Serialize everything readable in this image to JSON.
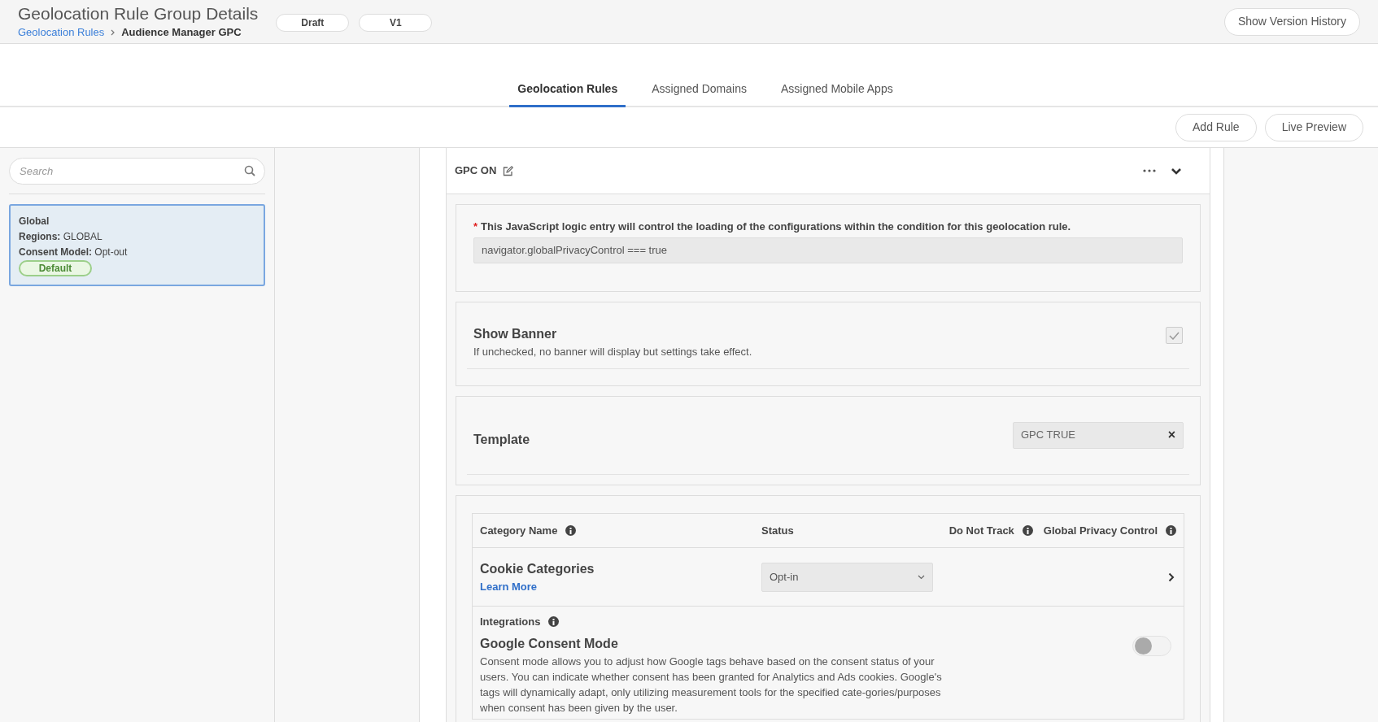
{
  "header": {
    "title": "Geolocation Rule Group Details",
    "breadcrumb": [
      {
        "label": "Geolocation Rules",
        "link": true
      },
      {
        "label": "Audience Manager GPC",
        "link": false
      }
    ],
    "badges": [
      "Draft",
      "V1"
    ],
    "version_button": "Show Version History"
  },
  "tabs": [
    {
      "label": "Geolocation Rules",
      "selected": true
    },
    {
      "label": "Assigned Domains",
      "selected": false
    },
    {
      "label": "Assigned Mobile Apps",
      "selected": false
    }
  ],
  "actions": [
    "Add Rule",
    "Live Preview"
  ],
  "sidebar": {
    "search": {
      "placeholder": "Search"
    },
    "items": [
      {
        "name": "Global",
        "regions_label": "Regions:",
        "regions": "GLOBAL",
        "consent_label": "Consent Model:",
        "consent": "Opt-out",
        "badge": "Default",
        "selected": true
      }
    ]
  },
  "rule": {
    "title": "GPC ON",
    "expanded": true,
    "condition": {
      "required_mark": "*",
      "label": "This JavaScript logic entry will control the loading of the configurations within the condition for this geolocation rule.",
      "value": "navigator.globalPrivacyControl === true"
    },
    "show_banner": {
      "title": "Show Banner",
      "description": "If unchecked, no banner will display but settings take effect.",
      "checked": true,
      "disabled": true
    },
    "template": {
      "label": "Template",
      "value": "GPC TRUE",
      "clear": "×"
    },
    "categories": {
      "columns": [
        "Category Name",
        "Status",
        "Do Not Track",
        "Global Privacy Control"
      ],
      "rows": [
        {
          "name": "Cookie Categories",
          "link": "Learn More",
          "status": "Opt-in"
        }
      ]
    },
    "integrations": {
      "label": "Integrations",
      "items": [
        {
          "title": "Google Consent Mode",
          "description": "Consent mode allows you to adjust how Google tags behave based on the consent status of your users. You can indicate whether consent has been granted for Analytics and Ads cookies. Google's tags will dynamically adapt, only utilizing measurement tools for the specified cate-gories/purposes when consent has been given by the user.",
          "on": false
        }
      ]
    }
  }
}
